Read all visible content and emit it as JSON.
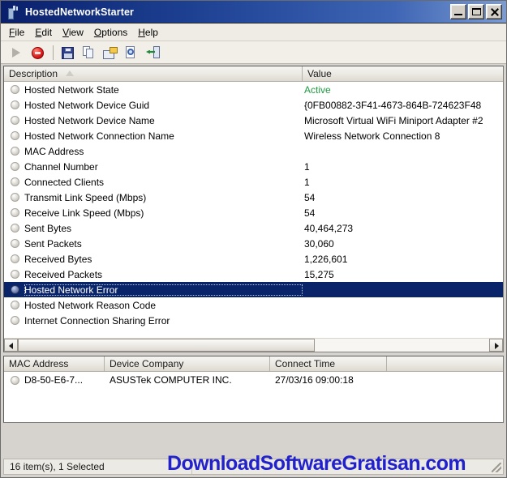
{
  "window": {
    "title": "HostedNetworkStarter",
    "icon": "network-adapter-icon",
    "buttons": {
      "minimize": "Minimize",
      "maximize": "Maximize",
      "close": "Close"
    }
  },
  "menubar": {
    "items": [
      {
        "label": "File",
        "accel": "F"
      },
      {
        "label": "Edit",
        "accel": "E"
      },
      {
        "label": "View",
        "accel": "V"
      },
      {
        "label": "Options",
        "accel": "O"
      },
      {
        "label": "Help",
        "accel": "H"
      }
    ]
  },
  "toolbar": {
    "buttons": [
      {
        "name": "start-hosted-network-button",
        "icon": "play-icon",
        "enabled": false
      },
      {
        "name": "stop-hosted-network-button",
        "icon": "stop-icon",
        "enabled": true
      },
      {
        "name": "save-button",
        "icon": "floppy-disk-icon",
        "enabled": true
      },
      {
        "name": "copy-button",
        "icon": "copy-pages-icon",
        "enabled": true
      },
      {
        "name": "properties-button",
        "icon": "folder-properties-icon",
        "enabled": true
      },
      {
        "name": "html-report-button",
        "icon": "magnifier-page-icon",
        "enabled": true
      },
      {
        "name": "exit-button",
        "icon": "exit-door-icon",
        "enabled": true
      }
    ]
  },
  "main_list": {
    "columns": [
      {
        "key": "description",
        "label": "Description",
        "sorted": "asc"
      },
      {
        "key": "value",
        "label": "Value"
      }
    ],
    "rows": [
      {
        "description": "Hosted Network State",
        "value": "Active",
        "value_color": "green",
        "selected": false
      },
      {
        "description": "Hosted Network Device Guid",
        "value": "{0FB00882-3F41-4673-864B-724623F48",
        "selected": false
      },
      {
        "description": "Hosted Network Device Name",
        "value": "Microsoft Virtual WiFi Miniport Adapter #2",
        "selected": false
      },
      {
        "description": "Hosted Network Connection Name",
        "value": "Wireless Network Connection 8",
        "selected": false
      },
      {
        "description": "MAC Address",
        "value": "",
        "selected": false
      },
      {
        "description": "Channel Number",
        "value": "1",
        "selected": false
      },
      {
        "description": "Connected Clients",
        "value": "1",
        "selected": false
      },
      {
        "description": "Transmit Link Speed (Mbps)",
        "value": "54",
        "selected": false
      },
      {
        "description": "Receive Link Speed (Mbps)",
        "value": "54",
        "selected": false
      },
      {
        "description": "Sent Bytes",
        "value": "40,464,273",
        "selected": false
      },
      {
        "description": "Sent Packets",
        "value": "30,060",
        "selected": false
      },
      {
        "description": "Received Bytes",
        "value": "1,226,601",
        "selected": false
      },
      {
        "description": "Received Packets",
        "value": "15,275",
        "selected": false
      },
      {
        "description": "Hosted Network Error",
        "value": "",
        "selected": true
      },
      {
        "description": "Hosted Network Reason Code",
        "value": "",
        "selected": false
      },
      {
        "description": "Internet Connection Sharing Error",
        "value": "",
        "selected": false
      }
    ]
  },
  "clients_list": {
    "columns": [
      {
        "key": "mac",
        "label": "MAC Address"
      },
      {
        "key": "company",
        "label": "Device Company"
      },
      {
        "key": "time",
        "label": "Connect Time"
      },
      {
        "key": "blank",
        "label": ""
      }
    ],
    "rows": [
      {
        "mac": "D8-50-E6-7...",
        "company": "ASUSTek COMPUTER INC.",
        "time": "27/03/16 09:00:18"
      }
    ]
  },
  "statusbar": {
    "text": "16 item(s), 1 Selected"
  },
  "watermark": {
    "text": "DownloadSoftwareGratisan.com",
    "color": "#2222cc"
  },
  "colors": {
    "title_bar": "#0a1f6b",
    "selection": "#0a246a",
    "active_value": "#1f9b3f",
    "window_face": "#d6d3ce"
  }
}
